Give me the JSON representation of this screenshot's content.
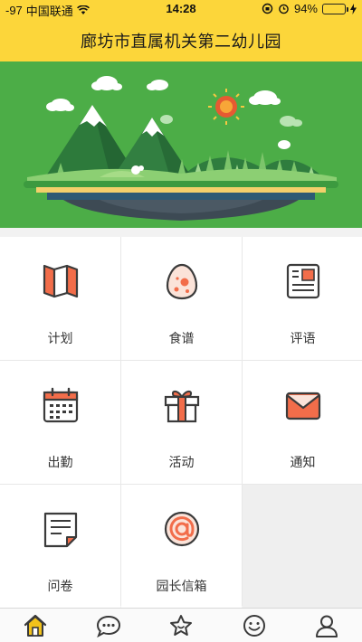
{
  "status_bar": {
    "signal": "-97",
    "carrier": "中国联通",
    "time": "14:28",
    "battery": "94%",
    "battery_level": 0.94
  },
  "header": {
    "title": "廊坊市直属机关第二幼儿园",
    "background_color": "#fcd63a"
  },
  "banner": {
    "background_color": "#4cad47",
    "illustration": "mountain-island-illustration"
  },
  "menu": {
    "items": [
      {
        "label": "计划",
        "icon": "plan-icon"
      },
      {
        "label": "食谱",
        "icon": "recipe-egg-icon"
      },
      {
        "label": "评语",
        "icon": "comment-icon"
      },
      {
        "label": "出勤",
        "icon": "calendar-icon"
      },
      {
        "label": "活动",
        "icon": "gift-icon"
      },
      {
        "label": "通知",
        "icon": "mail-icon"
      },
      {
        "label": "问卷",
        "icon": "questionnaire-icon"
      },
      {
        "label": "园长信箱",
        "icon": "at-sign-icon"
      }
    ]
  },
  "tabbar": {
    "tabs": [
      {
        "icon": "home-icon",
        "active": true
      },
      {
        "icon": "chat-icon",
        "active": false
      },
      {
        "icon": "star-icon",
        "active": false
      },
      {
        "icon": "smile-icon",
        "active": false
      },
      {
        "icon": "user-icon",
        "active": false
      }
    ],
    "active_color": "#f2c21b"
  }
}
